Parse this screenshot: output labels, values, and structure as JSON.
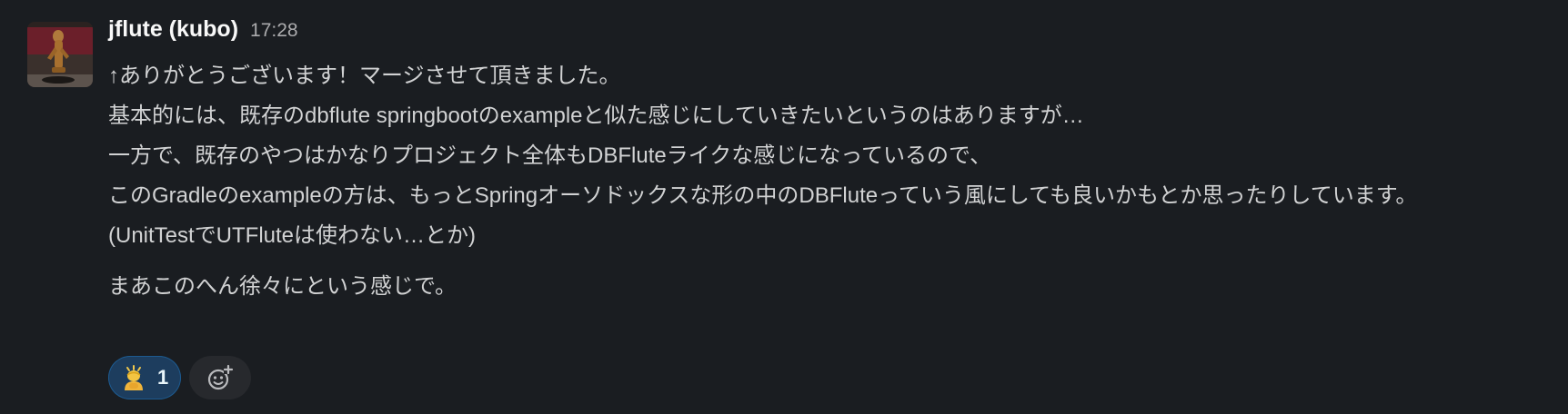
{
  "message": {
    "author": "jflute (kubo)",
    "time": "17:28",
    "avatar_icon": "user-avatar-figurine",
    "lines": [
      "↑ありがとうございます！マージさせて頂きました。",
      "基本的には、既存のdbflute springbootのexampleと似た感じにしていきたいというのはありますが…",
      "一方で、既存のやつはかなりプロジェクト全体もDBFluteライクな感じになっているので、",
      "このGradleのexampleの方は、もっとSpringオーソドックスな形の中のDBFluteっていう風にしても良いかもとか思ったりしています。",
      "(UnitTestでUTFluteは使わない…とか)"
    ],
    "second_paragraph": "まあこのへん徐々にという感じで。"
  },
  "reactions": [
    {
      "emoji": "person-bowing-emoji",
      "count": "1"
    }
  ],
  "add_reaction": {
    "icon": "add-emoji-icon"
  },
  "colors": {
    "background": "#1a1d21",
    "text": "#d1d2d3",
    "author": "#f8f8f8",
    "timestamp": "#ababad",
    "reaction_bg": "#1d3d5e",
    "reaction_border": "#1d5a8f"
  }
}
